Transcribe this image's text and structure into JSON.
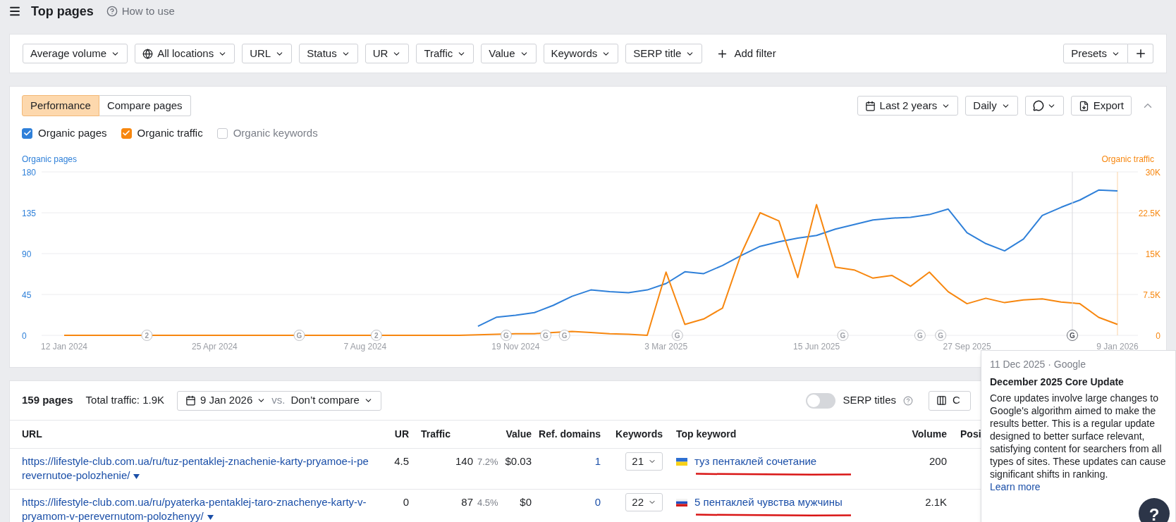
{
  "header": {
    "title": "Top pages",
    "help": "How to use"
  },
  "filters": [
    {
      "label": "Average volume",
      "kind": "dropdown"
    },
    {
      "label": "All locations",
      "kind": "globe"
    },
    {
      "label": "URL",
      "kind": "dropdown"
    },
    {
      "label": "Status",
      "kind": "dropdown"
    },
    {
      "label": "UR",
      "kind": "dropdown"
    },
    {
      "label": "Traffic",
      "kind": "dropdown"
    },
    {
      "label": "Value",
      "kind": "dropdown"
    },
    {
      "label": "Keywords",
      "kind": "dropdown"
    },
    {
      "label": "SERP title",
      "kind": "dropdown"
    },
    {
      "label": "Add filter",
      "kind": "add"
    }
  ],
  "presets": "Presets",
  "chart": {
    "tabs": [
      {
        "label": "Performance",
        "selected": true
      },
      {
        "label": "Compare pages",
        "selected": false
      }
    ],
    "range": "Last 2 years",
    "granularity": "Daily",
    "export": "Export",
    "toggles": [
      {
        "label": "Organic pages",
        "checked": true,
        "color": "#2f80d9"
      },
      {
        "label": "Organic traffic",
        "checked": true,
        "color": "#f7870f"
      },
      {
        "label": "Organic keywords",
        "checked": false,
        "color": "#c8cad0"
      }
    ],
    "chart_data": {
      "type": "line",
      "categories": [
        "12 Jan 2024",
        null,
        null,
        null,
        null,
        null,
        null,
        null,
        "25 Apr 2024",
        null,
        null,
        null,
        null,
        null,
        null,
        null,
        "7 Aug 2024",
        null,
        null,
        null,
        null,
        null,
        null,
        null,
        "19 Nov 2024",
        null,
        null,
        null,
        null,
        null,
        null,
        null,
        "3 Mar 2025",
        null,
        null,
        null,
        null,
        null,
        null,
        null,
        "15 Jun 2025",
        null,
        null,
        null,
        null,
        null,
        null,
        null,
        "27 Sep 2025",
        null,
        null,
        null,
        null,
        null,
        null,
        null,
        "9 Jan 2026"
      ],
      "series": [
        {
          "name": "Organic pages",
          "color": "#2f80d9",
          "values": [
            null,
            null,
            null,
            null,
            null,
            null,
            null,
            null,
            null,
            null,
            null,
            null,
            null,
            null,
            null,
            null,
            null,
            null,
            null,
            null,
            null,
            null,
            10,
            20,
            22,
            25,
            33,
            43,
            50,
            48,
            47,
            50,
            57,
            70,
            68,
            77,
            88,
            98,
            103,
            107,
            110,
            117,
            122,
            127,
            129,
            130,
            133,
            139,
            113,
            101,
            93,
            106,
            132,
            141,
            149,
            160,
            159
          ]
        },
        {
          "name": "Organic traffic",
          "color": "#f7870f",
          "axis": "y2",
          "values": [
            0,
            0,
            0,
            0,
            0,
            0,
            0,
            0,
            0,
            0,
            0,
            0,
            0,
            0,
            0,
            0,
            0,
            0,
            0,
            0,
            0,
            0,
            100,
            200,
            300,
            300,
            500,
            700,
            500,
            300,
            200,
            0,
            11600,
            2000,
            3000,
            5000,
            15000,
            22500,
            21000,
            10600,
            24000,
            12500,
            12000,
            10500,
            11000,
            9000,
            11600,
            8000,
            5800,
            6800,
            6000,
            6500,
            6700,
            6100,
            5800,
            3300,
            2000
          ]
        }
      ],
      "ylim": [
        0,
        180
      ],
      "y2lim": [
        0,
        30000
      ],
      "grid": true,
      "y2ticks": [
        {
          "value": 0,
          "label": "0"
        },
        {
          "value": 7500,
          "label": "7.5K"
        },
        {
          "value": 15000,
          "label": "15K"
        },
        {
          "value": 22500,
          "label": "22.5K"
        },
        {
          "value": 30000,
          "label": "30K"
        }
      ],
      "yticks": [
        0,
        45,
        90,
        135,
        180
      ]
    },
    "events": [
      {
        "text": "2"
      },
      {
        "text": "G"
      },
      {
        "text": "2"
      },
      {
        "text": "G"
      },
      {
        "text": "G"
      },
      {
        "text": "G"
      },
      {
        "text": "G"
      },
      {
        "text": "G"
      },
      {
        "text": "G"
      },
      {
        "text": "G"
      },
      {
        "text": "G",
        "hovered": true
      }
    ]
  },
  "table": {
    "count": "159 pages",
    "total": "Total traffic: 1.9K",
    "date": "9 Jan 2026",
    "vs": "vs.",
    "compare": "Don’t compare",
    "serp_toggle": {
      "label": "SERP titles",
      "on": false
    },
    "columns_button": "C",
    "columns": [
      "URL",
      "UR",
      "Traffic",
      "Value",
      "Ref. domains",
      "Keywords",
      "Top keyword",
      "Volume",
      "Posi"
    ],
    "rows": [
      {
        "url": "https://lifestyle-club.com.ua/ru/tuz-pentaklej-znachenie-karty-pryamoe-i-perevernutoe-polozhenie/",
        "ur": "4.5",
        "traffic": "140",
        "share": "7.2%",
        "value": "$0.03",
        "ref_domains": "1",
        "keywords": "21",
        "kind": "ukraine",
        "keyword": "туз пентаклей сочетание",
        "underlined": true,
        "volume": "200"
      },
      {
        "url": "https://lifestyle-club.com.ua/ru/pyaterka-pentaklej-taro-znachenye-karty-v-pryamom-v-perevernutom-polozhenyy/",
        "ur": "0",
        "traffic": "87",
        "share": "4.5%",
        "value": "$0",
        "ref_domains": "0",
        "keywords": "22",
        "kind": "russia",
        "keyword": "5 пентаклей чувства мужчины",
        "underlined": true,
        "volume": "2.1K"
      }
    ]
  },
  "tooltip": {
    "meta": "11 Dec 2025 · Google",
    "title": "December 2025 Core Update",
    "body": "Core updates involve large changes to Google's algorithm aimed to make the results better. This is a regular update designed to better surface relevant, satisfying content for searchers from all types of sites. These updates can cause significant shifts in ranking.",
    "link": "Learn more"
  },
  "help_button": "?"
}
